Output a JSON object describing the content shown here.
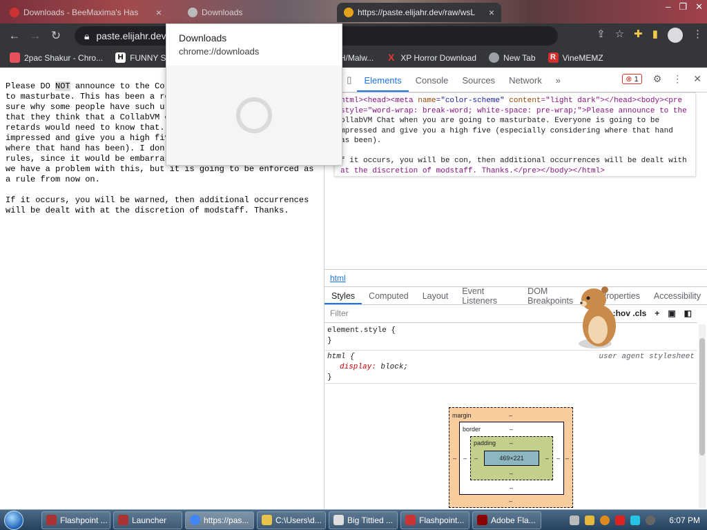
{
  "browser": {
    "tabs": [
      {
        "label": "Downloads - BeeMaxima's Has",
        "active": false
      },
      {
        "label": "Downloads",
        "active": false
      },
      {
        "label": "https://paste.elijahr.dev/raw/wsL",
        "active": true
      }
    ],
    "address": "paste.elijahr.dev",
    "bookmarks": [
      {
        "label": "2pac Shakur - Chro...",
        "color": "#e8505b"
      },
      {
        "label": "FUNNY SI",
        "color": "#222"
      },
      {
        "label": "H/Malw...",
        "color": "#888"
      },
      {
        "label": "XP Horror Download",
        "color": "#e53935"
      },
      {
        "label": "New Tab",
        "color": "#9aa0a6"
      },
      {
        "label": "VineMEMZ",
        "color": "#d32f2f"
      }
    ]
  },
  "downloads_popup": {
    "title": "Downloads",
    "url": "chrome://downloads"
  },
  "page_text": {
    "line1_pre": "Please DO ",
    "line1_hl": "NOT",
    "line1_post": " announce to the Col",
    "rest": "to masturbate. This has been a re\nsure why some people have such ur\nthat they think that a CollabVM c\nretards would need to know that.\nimpressed and give you a high fiv\nwhere that hand has been). I don\nrules, since it would be embarras\nwe have a problem with this, but it is going to be enforced as\na rule from now on.\n\nIf it occurs, you will be warned, then additional occurrences\nwill be dealt with at the discretion of modstaff. Thanks."
  },
  "devtools": {
    "tabs": [
      "Elements",
      "Console",
      "Sources",
      "Network"
    ],
    "active_tab": "Elements",
    "error_count": "1",
    "source": {
      "l1a": "html><head><meta ",
      "l1b": "name",
      "l1c": "=\"color-scheme\" ",
      "l1d": "content",
      "l1e": "=\"light dark\"></head><body><pre",
      "l2": "style=\"word-wrap: break-word; white-space: pre-wrap;\">Please announce to the",
      "l3": "ollabVM Chat when you are going to masturbate. Everyone is going to be",
      "l4": "mpressed and give you a high five (especially considering where that hand",
      "l5": "as been).",
      "l6": "f it occurs, you will be con, then additional occurrences will be dealt with",
      "l7": "at the discretion of modstaff. Thanks.</pre></body></html>"
    },
    "breadcrumb": "html",
    "sub_tabs": [
      "Styles",
      "Computed",
      "Layout",
      "Event Listeners",
      "DOM Breakpoints",
      "Properties",
      "Accessibility"
    ],
    "active_sub_tab": "Styles",
    "filter_placeholder": "Filter",
    "cls_label": ":hov .cls",
    "rule1_selector": "element.style {",
    "rule1_close": "}",
    "rule2_selector": "html {",
    "rule2_prop": "display",
    "rule2_value": "block;",
    "rule2_close": "}",
    "rule2_source": "user agent stylesheet",
    "boxmodel": {
      "margin_label": "margin",
      "border_label": "border",
      "padding_label": "padding",
      "content_size": "469×221",
      "dash": "–"
    }
  },
  "taskbar": {
    "items": [
      {
        "label": "Flashpoint ...",
        "color": "#a33"
      },
      {
        "label": "Launcher",
        "color": "#a33"
      },
      {
        "label": "https://pas...",
        "color": "#4285f4"
      },
      {
        "label": "C:\\Users\\d...",
        "color": "#e8c34b"
      },
      {
        "label": "Big Tittied ...",
        "color": "#ddd"
      },
      {
        "label": "Flashpoint...",
        "color": "#c33"
      },
      {
        "label": "Adobe Fla...",
        "color": "#8b0000"
      }
    ],
    "clock": "6:07 PM"
  }
}
